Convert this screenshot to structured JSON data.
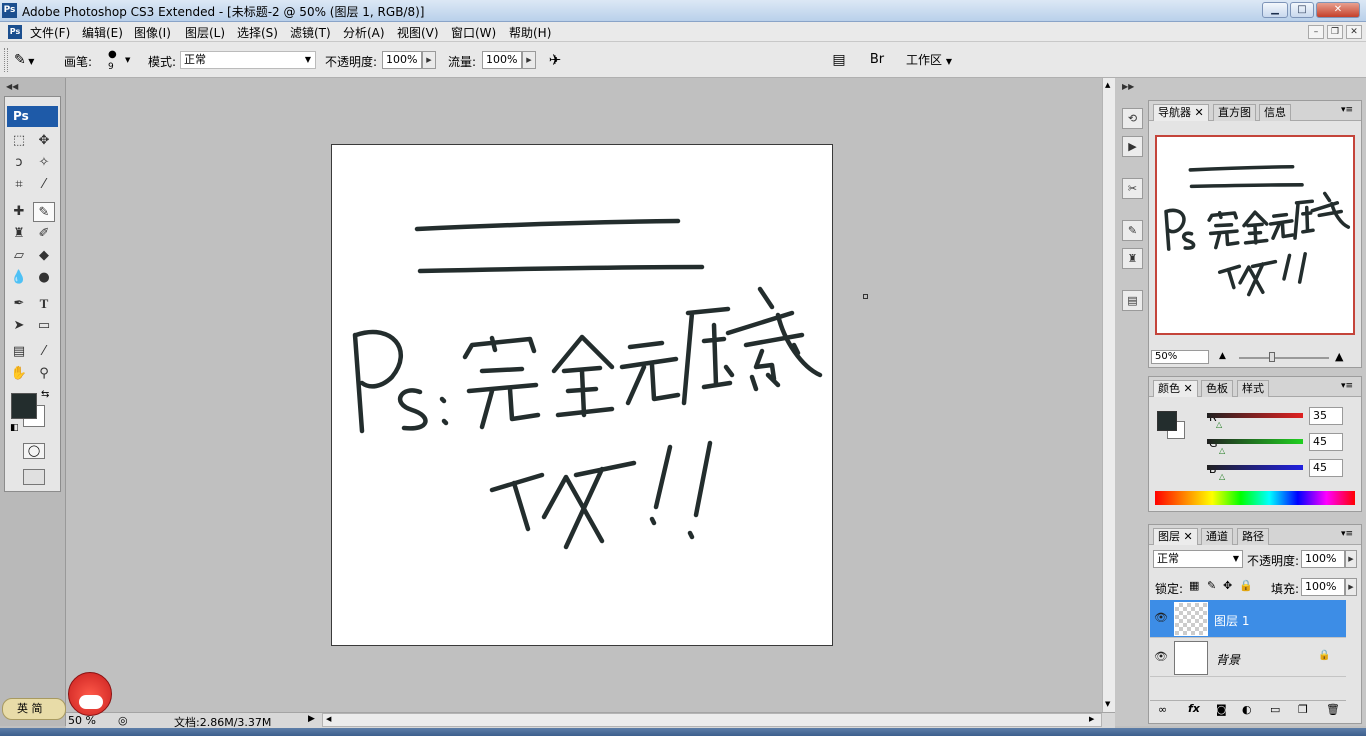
{
  "titlebar": {
    "app_icon": "Ps",
    "title": "Adobe Photoshop CS3 Extended - [未标题-2 @ 50% (图层 1, RGB/8)]"
  },
  "window_controls": {
    "minimize": "▁",
    "maximize": "□",
    "close": "✕"
  },
  "menus": [
    "文件(F)",
    "编辑(E)",
    "图像(I)",
    "图层(L)",
    "选择(S)",
    "滤镜(T)",
    "分析(A)",
    "视图(V)",
    "窗口(W)",
    "帮助(H)"
  ],
  "options": {
    "brush_label": "画笔:",
    "brush_size": "9",
    "mode_label": "模式:",
    "mode_value": "正常",
    "opacity_label": "不透明度:",
    "opacity_value": "100%",
    "flow_label": "流量:",
    "flow_value": "100%",
    "workspace_label": "工作区"
  },
  "navigator": {
    "tabs": [
      "导航器",
      "直方图",
      "信息"
    ],
    "zoom": "50%"
  },
  "color_panel": {
    "tabs": [
      "颜色",
      "色板",
      "样式"
    ],
    "channels": [
      {
        "name": "R",
        "value": "35"
      },
      {
        "name": "G",
        "value": "45"
      },
      {
        "name": "B",
        "value": "45"
      }
    ],
    "foreground": "#232d2d"
  },
  "layers_panel": {
    "tabs": [
      "图层",
      "通道",
      "路径"
    ],
    "blend_mode": "正常",
    "opacity_label": "不透明度:",
    "opacity_value": "100%",
    "lock_label": "锁定:",
    "fill_label": "填充:",
    "fill_value": "100%",
    "layers": [
      {
        "name": "图层 1",
        "selected": true
      },
      {
        "name": "背景",
        "selected": false
      }
    ]
  },
  "status": {
    "zoom": "50 %",
    "doc_info": "文档:2.86M/3.37M"
  },
  "ime": {
    "label": "英 简"
  },
  "canvas_text": {
    "line1": "Ps:完全无压感",
    "line2": "T^T!!"
  }
}
